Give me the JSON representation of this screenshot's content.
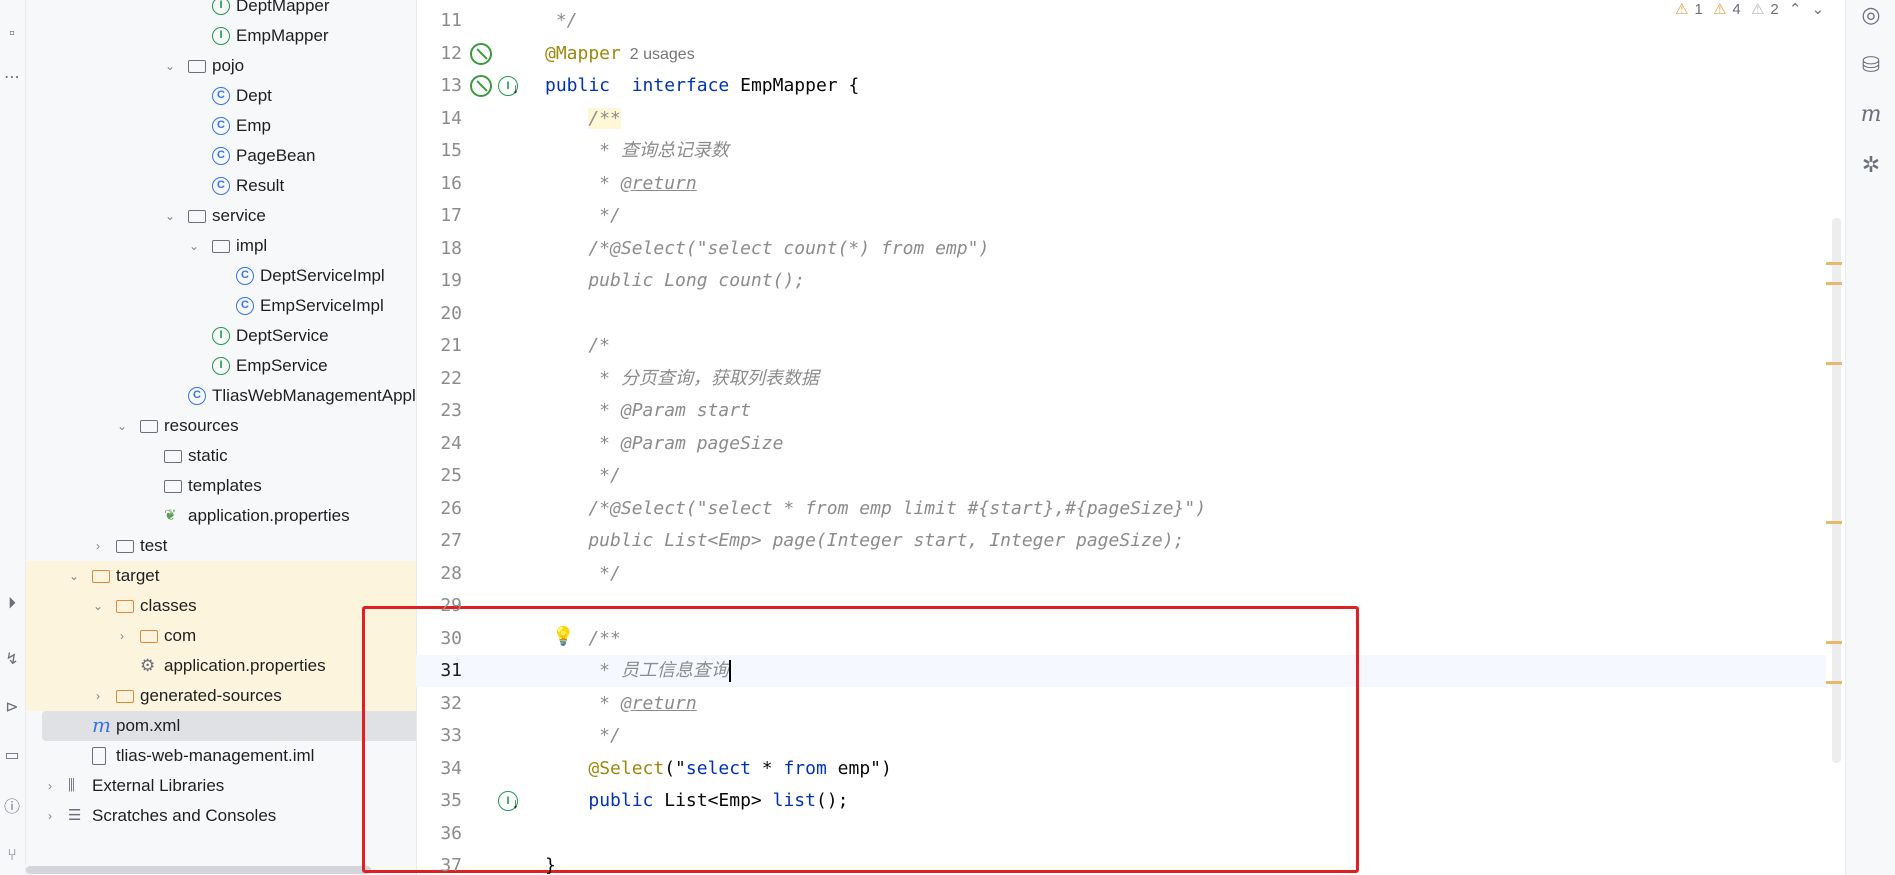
{
  "project_tree": [
    {
      "label": "DeptMapper",
      "icon": "interface-icon",
      "indent": 7
    },
    {
      "label": "EmpMapper",
      "icon": "interface-icon",
      "indent": 7
    },
    {
      "label": "pojo",
      "icon": "package-icon",
      "indent": 6,
      "expanded": true
    },
    {
      "label": "Dept",
      "icon": "class-icon",
      "indent": 7
    },
    {
      "label": "Emp",
      "icon": "class-icon",
      "indent": 7
    },
    {
      "label": "PageBean",
      "icon": "class-icon",
      "indent": 7
    },
    {
      "label": "Result",
      "icon": "class-icon",
      "indent": 7
    },
    {
      "label": "service",
      "icon": "package-icon",
      "indent": 6,
      "expanded": true
    },
    {
      "label": "impl",
      "icon": "package-icon",
      "indent": 7,
      "expanded": true
    },
    {
      "label": "DeptServiceImpl",
      "icon": "class-icon",
      "indent": 8
    },
    {
      "label": "EmpServiceImpl",
      "icon": "class-icon",
      "indent": 8
    },
    {
      "label": "DeptService",
      "icon": "interface-icon",
      "indent": 7
    },
    {
      "label": "EmpService",
      "icon": "interface-icon",
      "indent": 7
    },
    {
      "label": "TliasWebManagementApplic",
      "icon": "spring-boot-class-icon",
      "indent": 6
    },
    {
      "label": "resources",
      "icon": "resources-folder-icon",
      "indent": 4,
      "expanded": true
    },
    {
      "label": "static",
      "icon": "folder-icon",
      "indent": 5
    },
    {
      "label": "templates",
      "icon": "folder-icon",
      "indent": 5
    },
    {
      "label": "application.properties",
      "icon": "spring-properties-icon",
      "indent": 5
    },
    {
      "label": "test",
      "icon": "folder-icon",
      "indent": 3,
      "expanded": false
    },
    {
      "label": "target",
      "icon": "excluded-folder-icon",
      "indent": 2,
      "expanded": true,
      "excluded": true
    },
    {
      "label": "classes",
      "icon": "excluded-folder-icon",
      "indent": 3,
      "expanded": true,
      "excluded": true
    },
    {
      "label": "com",
      "icon": "excluded-folder-icon",
      "indent": 4,
      "expanded": false,
      "excluded": true
    },
    {
      "label": "application.properties",
      "icon": "properties-gear-icon",
      "indent": 4,
      "excluded": true
    },
    {
      "label": "generated-sources",
      "icon": "excluded-folder-icon",
      "indent": 3,
      "expanded": false,
      "excluded": true
    },
    {
      "label": "pom.xml",
      "icon": "maven-icon",
      "indent": 2,
      "selected": true
    },
    {
      "label": "tlias-web-management.iml",
      "icon": "file-icon",
      "indent": 2
    },
    {
      "label": "External Libraries",
      "icon": "library-icon",
      "indent": 1,
      "expanded": false
    },
    {
      "label": "Scratches and Consoles",
      "icon": "scratches-icon",
      "indent": 1,
      "expanded": false
    }
  ],
  "editor": {
    "inspections": {
      "warnings_a": "1",
      "warnings_b": "4",
      "warnings_c": "2"
    },
    "current_line": "31",
    "lines": [
      {
        "n": "11",
        "html": " */"
      },
      {
        "n": "12",
        "segments": [
          [
            "ann",
            "@Mapper"
          ],
          [
            "usages",
            "  2 usages"
          ]
        ]
      },
      {
        "n": "13",
        "segments": [
          [
            "kw",
            "public"
          ],
          [
            "",
            "  "
          ],
          [
            "kw",
            "interface"
          ],
          [
            "",
            " EmpMapper {"
          ]
        ]
      },
      {
        "n": "14",
        "segments": [
          [
            "",
            "    "
          ],
          [
            "doc-bg doc",
            "/**"
          ]
        ]
      },
      {
        "n": "15",
        "segments": [
          [
            "doc",
            "     * 查询总记录数"
          ]
        ]
      },
      {
        "n": "16",
        "segments": [
          [
            "doc",
            "     * "
          ],
          [
            "doctag",
            "@return"
          ]
        ]
      },
      {
        "n": "17",
        "segments": [
          [
            "doc",
            "     */"
          ]
        ]
      },
      {
        "n": "18",
        "segments": [
          [
            "cmt",
            "    /*@Select(\"select count(*) from emp\")"
          ]
        ]
      },
      {
        "n": "19",
        "segments": [
          [
            "cmt",
            "    public Long count();"
          ]
        ]
      },
      {
        "n": "20",
        "segments": [
          [
            "",
            ""
          ]
        ]
      },
      {
        "n": "21",
        "segments": [
          [
            "cmt",
            "    /*"
          ]
        ]
      },
      {
        "n": "22",
        "segments": [
          [
            "cmt",
            "     * 分页查询，获取列表数据"
          ]
        ]
      },
      {
        "n": "23",
        "segments": [
          [
            "cmt",
            "     * @Param start"
          ]
        ]
      },
      {
        "n": "24",
        "segments": [
          [
            "cmt",
            "     * @Param pageSize"
          ]
        ]
      },
      {
        "n": "25",
        "segments": [
          [
            "cmt",
            "     */"
          ]
        ]
      },
      {
        "n": "26",
        "segments": [
          [
            "cmt",
            "    /*@Select(\"select * from emp limit #{start},#{pageSize}\")"
          ]
        ]
      },
      {
        "n": "27",
        "segments": [
          [
            "cmt",
            "    public List<Emp> page(Integer start, Integer pageSize);"
          ]
        ]
      },
      {
        "n": "28",
        "segments": [
          [
            "cmt",
            "     */"
          ]
        ]
      },
      {
        "n": "29",
        "segments": [
          [
            "",
            ""
          ]
        ]
      },
      {
        "n": "30",
        "segments": [
          [
            "doc",
            "    /**"
          ]
        ]
      },
      {
        "n": "31",
        "segments": [
          [
            "doc",
            "     * 员工信息查询"
          ],
          [
            "caret",
            ""
          ]
        ]
      },
      {
        "n": "32",
        "segments": [
          [
            "doc",
            "     * "
          ],
          [
            "doctag",
            "@return"
          ]
        ]
      },
      {
        "n": "33",
        "segments": [
          [
            "doc",
            "     */"
          ]
        ]
      },
      {
        "n": "34",
        "segments": [
          [
            "",
            "    "
          ],
          [
            "ann",
            "@Select"
          ],
          [
            "",
            "(\""
          ],
          [
            "sqlkw",
            "select"
          ],
          [
            "",
            " * "
          ],
          [
            "sqlkw",
            "from"
          ],
          [
            "",
            " emp\")"
          ]
        ]
      },
      {
        "n": "35",
        "segments": [
          [
            "",
            "    "
          ],
          [
            "kw",
            "public"
          ],
          [
            "",
            " List<Emp> "
          ],
          [
            "kw",
            "list"
          ],
          [
            "",
            "();"
          ]
        ]
      },
      {
        "n": "36",
        "segments": [
          [
            "",
            ""
          ]
        ]
      },
      {
        "n": "37",
        "segments": [
          [
            "",
            "}"
          ]
        ]
      }
    ]
  },
  "colors": {
    "highlight_frame": "#e02020",
    "excluded_bg": "#fdf4de",
    "annotation": "#9e880d",
    "keyword": "#0033b3"
  }
}
